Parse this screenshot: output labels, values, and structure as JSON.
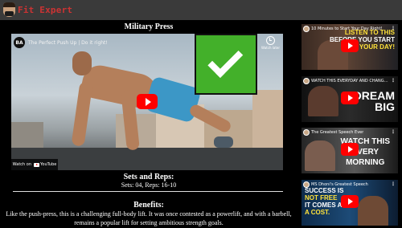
{
  "header": {
    "logo_text": "Fit Expert"
  },
  "main": {
    "title": "Military Press",
    "video": {
      "channel_icon_text": "BA",
      "title": "The Perfect Push Up | Do it right!",
      "watch_later_label": "Watch later",
      "watch_on_label": "Watch on",
      "youtube_label": "YouTube"
    },
    "sets_heading": "Sets and Reps:",
    "sets_values": "Sets: 04, Reps: 16-10",
    "benefits_heading": "Benefits:",
    "benefits_text": "Like the push-press, this is a challenging full-body lift. It was once contested as a powerlift, and with a barbell, remains a popular lift for setting ambitious strength goals."
  },
  "sidebar": {
    "videos": [
      {
        "title": "10 Minutes to Start Your Day Right!",
        "overlay_line1": "LISTEN TO THIS",
        "overlay_line2": "BEFORE YOU START",
        "overlay_line3": "YOUR DAY!"
      },
      {
        "title": "WATCH THIS EVERYDAY AND CHANGE YOUR LIFE",
        "overlay_line1": "DREAM",
        "overlay_line2": "BIG"
      },
      {
        "title": "The Greatest Speech Ever",
        "overlay_line1": "WATCH THIS",
        "overlay_line2": "EVERY",
        "overlay_line3": "MORNING"
      },
      {
        "title": "MS Dhoni's Greatest Speech",
        "overlay_line1": "SUCCESS IS",
        "overlay_line2": "NOT FREE",
        "overlay_line3": "IT COMES AT",
        "overlay_line4": "A COST."
      }
    ]
  }
}
